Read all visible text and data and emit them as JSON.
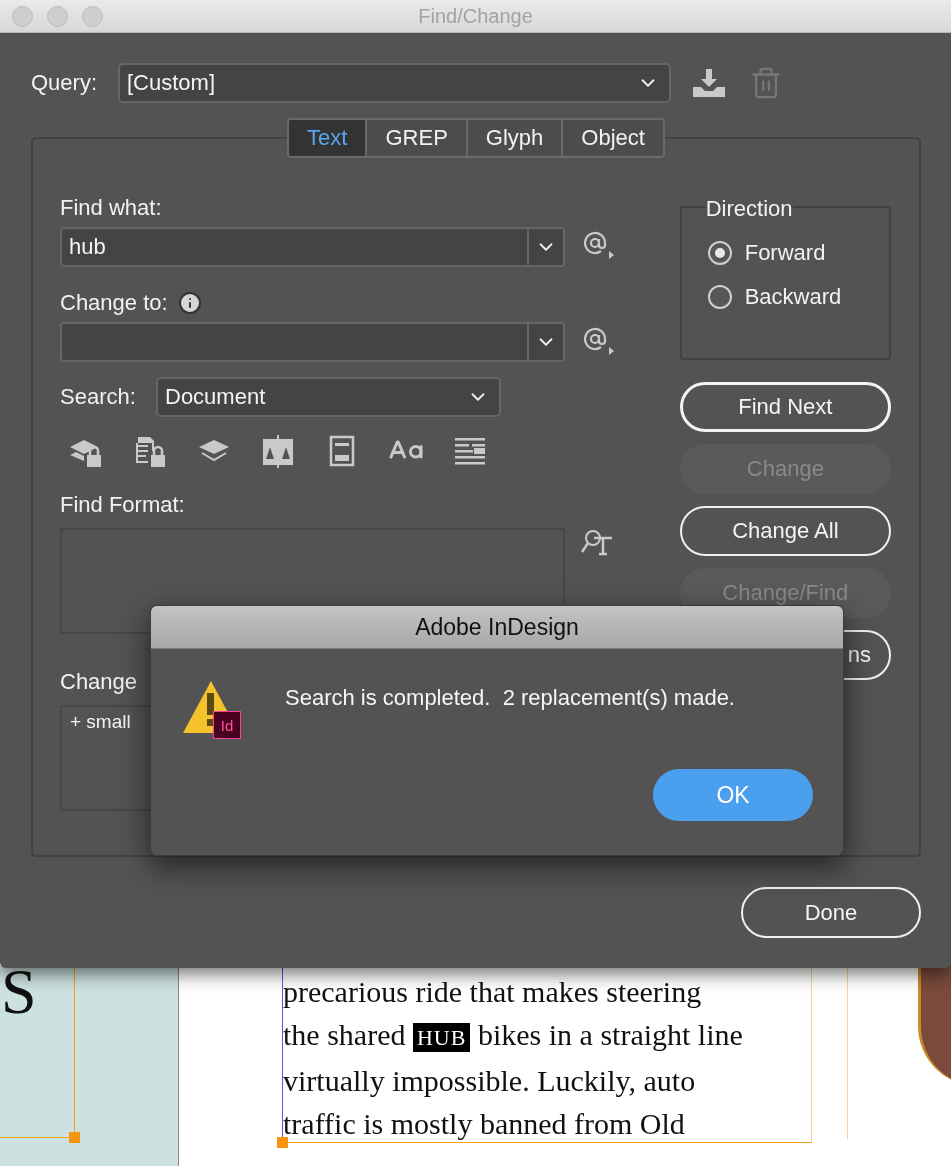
{
  "window": {
    "title": "Find/Change"
  },
  "query": {
    "label": "Query:",
    "value": "[Custom]"
  },
  "tabs": [
    {
      "label": "Text",
      "selected": true
    },
    {
      "label": "GREP",
      "selected": false
    },
    {
      "label": "Glyph",
      "selected": false
    },
    {
      "label": "Object",
      "selected": false
    }
  ],
  "find_what": {
    "label": "Find what:",
    "value": "hub"
  },
  "change_to": {
    "label": "Change to:"
  },
  "search": {
    "label": "Search:",
    "value": "Document"
  },
  "find_format": {
    "label": "Find Format:"
  },
  "change_format": {
    "label": "Change",
    "items": [
      "+ small"
    ]
  },
  "direction": {
    "title": "Direction",
    "options": [
      {
        "label": "Forward",
        "selected": true
      },
      {
        "label": "Backward",
        "selected": false
      }
    ]
  },
  "buttons": [
    {
      "label": "Find Next",
      "disabled": false,
      "default": true
    },
    {
      "label": "Change",
      "disabled": true,
      "default": false
    },
    {
      "label": "Change All",
      "disabled": false,
      "default": false
    },
    {
      "label": "Change/Find",
      "disabled": true,
      "default": false
    },
    {
      "label": "ns",
      "disabled": false,
      "default": false
    }
  ],
  "done": "Done",
  "alert": {
    "title": "Adobe InDesign",
    "badge": "Id",
    "message": "Search is completed.  2 replacement(s) made.",
    "button": "OK"
  },
  "document": {
    "drop_letter": "S",
    "lines": [
      [
        {
          "text": "precarious ride that makes steering",
          "highlighted": false
        }
      ],
      [
        {
          "text": "the shared ",
          "highlighted": false
        },
        {
          "text": "HUB",
          "highlighted": true
        },
        {
          "text": " bikes in a straight line",
          "highlighted": false
        }
      ],
      [
        {
          "text": "virtually impossible. Luckily, auto",
          "highlighted": false
        }
      ],
      [
        {
          "text": "traffic is mostly banned from Old",
          "highlighted": false
        }
      ]
    ]
  }
}
